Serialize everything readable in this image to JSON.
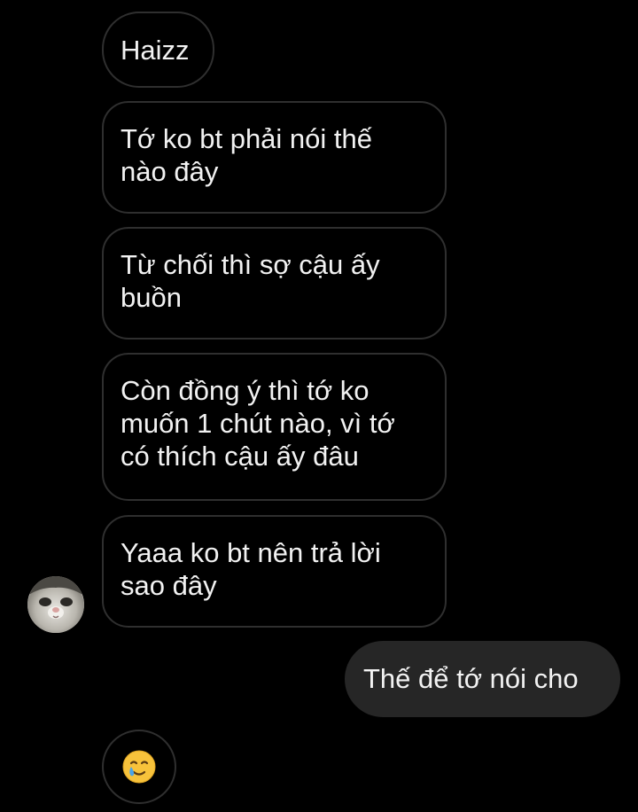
{
  "conversation": {
    "incoming_messages": [
      {
        "text": "Haizz"
      },
      {
        "text": "Tớ ko bt phải nói thế\nnào đây"
      },
      {
        "text": "Từ chối thì sợ cậu ấy\nbuồn"
      },
      {
        "text": "Còn đồng ý thì tớ ko\nmuốn 1 chút nào, vì tớ\ncó thích cậu ấy đâu"
      },
      {
        "text": "Yaaa ko bt nên trả lời\nsao đây"
      }
    ],
    "outgoing_message": {
      "text": "Thế để tớ nói cho"
    },
    "reaction_emoji": "smiling-face-with-tear",
    "contact_avatar": "cat-face-avatar"
  },
  "colors": {
    "background": "#000000",
    "incoming_border": "#2f2f2f",
    "outgoing_bubble": "#262626",
    "text": "#f2f2f2",
    "emoji_yellow": "#f7c23b",
    "tear_blue": "#4aa3ea"
  }
}
